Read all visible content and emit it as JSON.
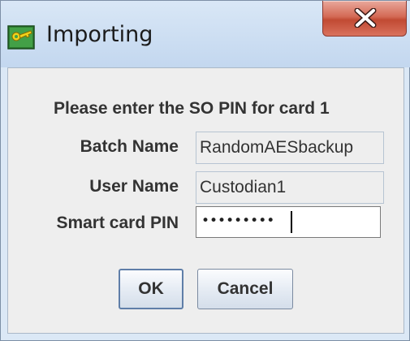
{
  "window": {
    "title": "Importing",
    "icons": {
      "app": "key-card-icon",
      "close": "close-x-icon"
    }
  },
  "form": {
    "heading_prefix": "Please enter the SO PIN for card ",
    "card_number": "1",
    "batch_name_label": "Batch Name",
    "batch_name_value": "RandomAESbackup",
    "user_name_label": "User Name",
    "user_name_value": "Custodian1",
    "pin_label": "Smart card PIN",
    "pin_masked": "•••••••••"
  },
  "buttons": {
    "ok_label": "OK",
    "cancel_label": "Cancel"
  },
  "colors": {
    "titlebar": "#cfe0f3",
    "close_button": "#c14a33",
    "panel_background": "#eeeeee"
  }
}
